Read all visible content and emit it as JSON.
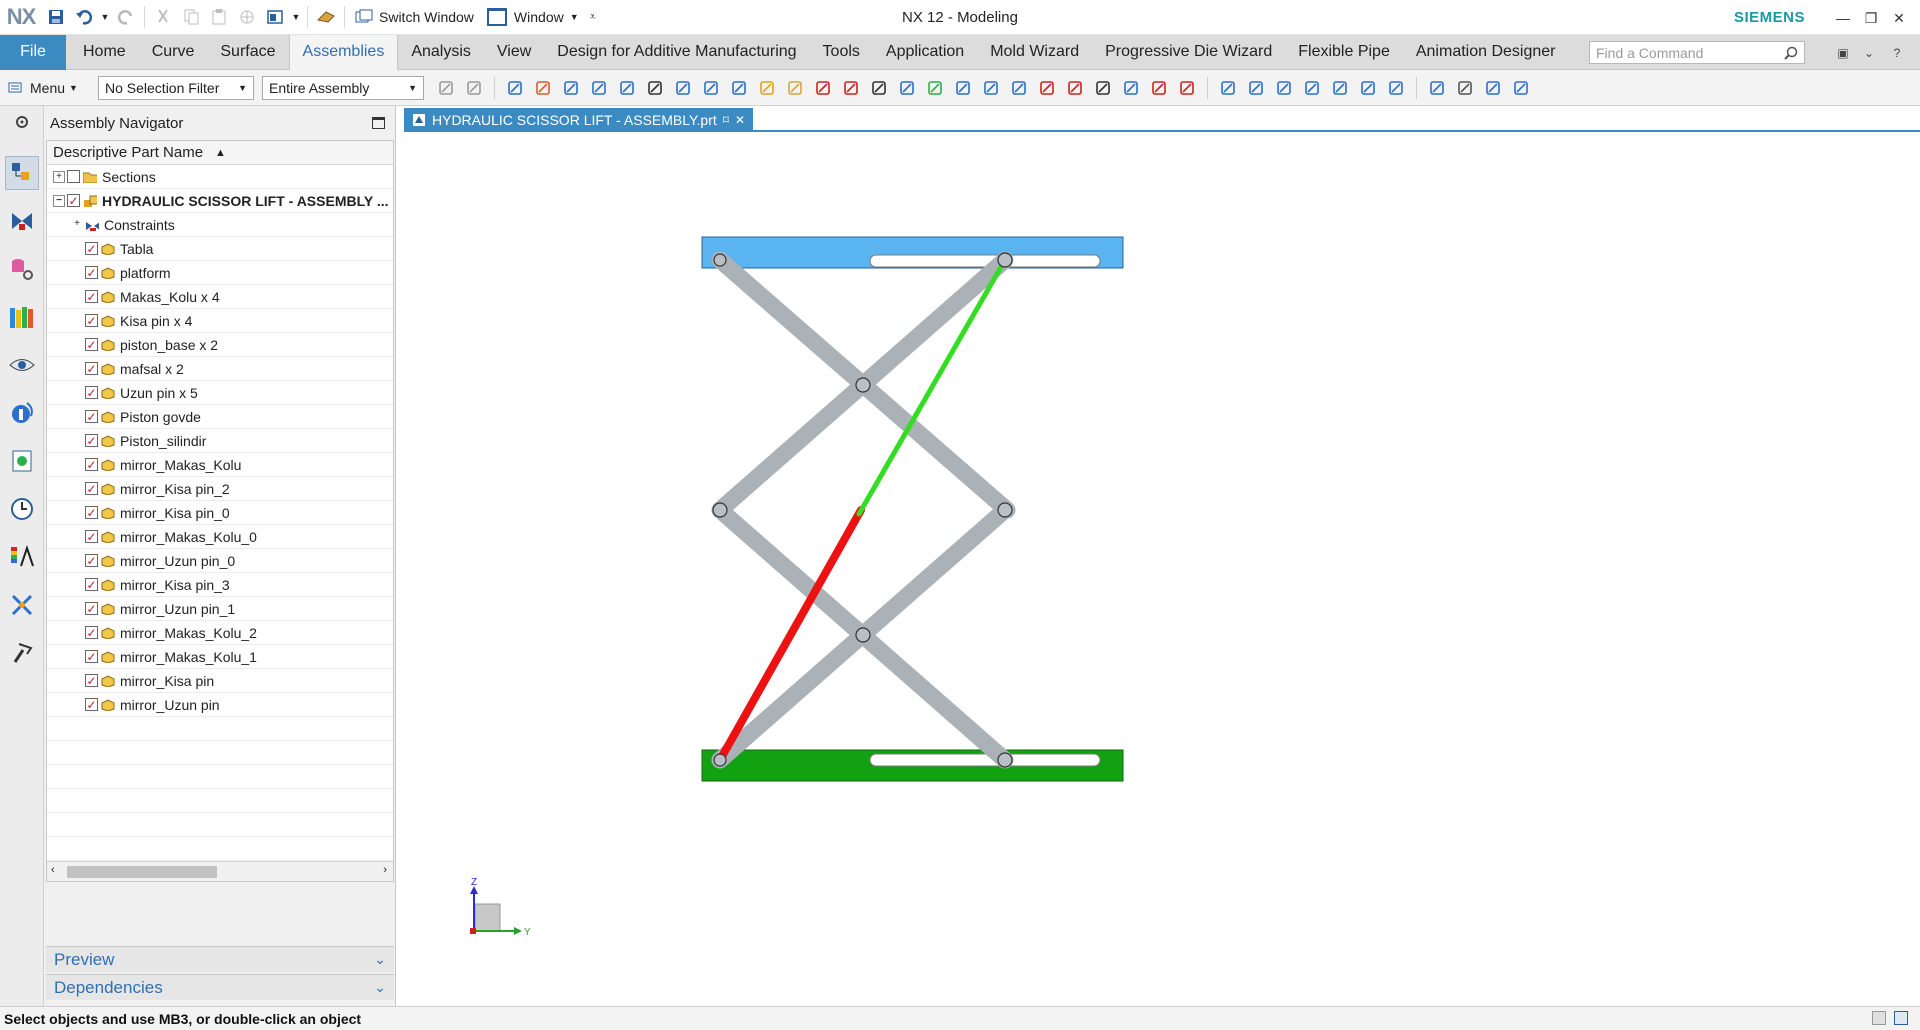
{
  "app": {
    "logo": "NX",
    "title": "NX 12 - Modeling",
    "brand": "SIEMENS",
    "switch_window": "Switch Window",
    "window_menu": "Window"
  },
  "ribbon": {
    "file": "File",
    "tabs": [
      "Home",
      "Curve",
      "Surface",
      "Assemblies",
      "Analysis",
      "View",
      "Design for Additive Manufacturing",
      "Tools",
      "Application",
      "Mold Wizard",
      "Progressive Die Wizard",
      "Flexible Pipe",
      "Animation Designer"
    ],
    "active_tab": "Assemblies",
    "find_command_placeholder": "Find a Command"
  },
  "selection_bar": {
    "menu": "Menu",
    "filter": "No Selection Filter",
    "scope": "Entire Assembly"
  },
  "navigator": {
    "title": "Assembly Navigator",
    "column": "Descriptive Part Name",
    "sections": "Sections",
    "root": "HYDRAULIC SCISSOR LIFT - ASSEMBLY ...",
    "constraints": "Constraints",
    "parts": [
      "Tabla",
      "platform",
      "Makas_Kolu x 4",
      "Kisa pin x 4",
      "piston_base x 2",
      "mafsal x 2",
      "Uzun pin x 5",
      "Piston govde",
      "Piston_silindir",
      "mirror_Makas_Kolu",
      "mirror_Kisa pin_2",
      "mirror_Kisa pin_0",
      "mirror_Makas_Kolu_0",
      "mirror_Uzun pin_0",
      "mirror_Kisa pin_3",
      "mirror_Uzun pin_1",
      "mirror_Makas_Kolu_2",
      "mirror_Makas_Kolu_1",
      "mirror_Kisa pin",
      "mirror_Uzun pin"
    ],
    "preview": "Preview",
    "dependencies": "Dependencies"
  },
  "document": {
    "tab_label": "HYDRAULIC SCISSOR LIFT - ASSEMBLY.prt"
  },
  "triad": {
    "z": "Z",
    "y": "Y"
  },
  "status": {
    "message": "Select objects and use MB3, or double-click an object"
  },
  "colors": {
    "accent": "#3b8bc2",
    "table_top": "#5ab4f0",
    "base_plate": "#11a111",
    "scissor_arm": "#aab2b8",
    "piston_rod": "#33dd22",
    "piston_body": "#ee1111"
  }
}
